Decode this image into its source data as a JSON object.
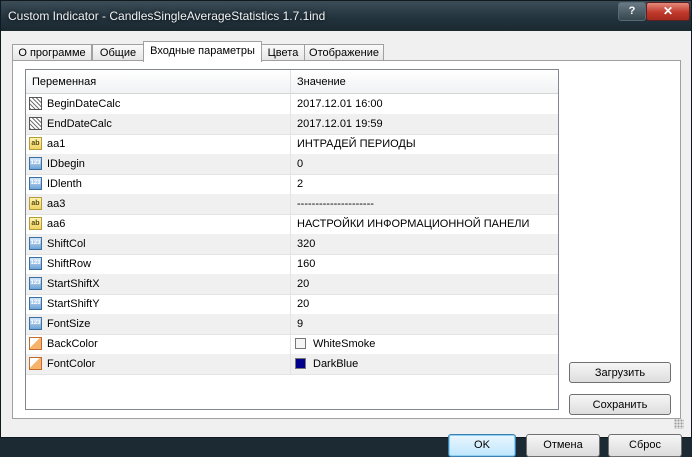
{
  "window": {
    "title": "Custom Indicator - CandlesSingleAverageStatistics 1.7.1ind",
    "help_label": "?",
    "close_label": "✕"
  },
  "tabs": [
    {
      "label": "О программе",
      "active": false
    },
    {
      "label": "Общие",
      "active": false
    },
    {
      "label": "Входные параметры",
      "active": true
    },
    {
      "label": "Цвета",
      "active": false
    },
    {
      "label": "Отображение",
      "active": false
    }
  ],
  "grid": {
    "headers": {
      "name": "Переменная",
      "value": "Значение"
    },
    "rows": [
      {
        "icon": "datetime-icon",
        "name": "BeginDateCalc",
        "value": "2017.12.01 16:00"
      },
      {
        "icon": "datetime-icon",
        "name": "EndDateCalc",
        "value": "2017.12.01 19:59"
      },
      {
        "icon": "string-icon",
        "name": "aa1",
        "value": "ИНТРАДЕЙ ПЕРИОДЫ"
      },
      {
        "icon": "integer-icon",
        "name": "IDbegin",
        "value": "0"
      },
      {
        "icon": "integer-icon",
        "name": "IDlenth",
        "value": "2"
      },
      {
        "icon": "string-icon",
        "name": "aa3",
        "value": "---------------------"
      },
      {
        "icon": "string-icon",
        "name": "aa6",
        "value": "НАСТРОЙКИ ИНФОРМАЦИОННОЙ ПАНЕЛИ"
      },
      {
        "icon": "integer-icon",
        "name": "ShiftCol",
        "value": "320"
      },
      {
        "icon": "integer-icon",
        "name": "ShiftRow",
        "value": "160"
      },
      {
        "icon": "integer-icon",
        "name": "StartShiftX",
        "value": "20"
      },
      {
        "icon": "integer-icon",
        "name": "StartShiftY",
        "value": "20"
      },
      {
        "icon": "integer-icon",
        "name": "FontSize",
        "value": "9"
      },
      {
        "icon": "color-icon",
        "name": "BackColor",
        "value": "WhiteSmoke",
        "swatch": "#f5f5f5"
      },
      {
        "icon": "color-icon",
        "name": "FontColor",
        "value": "DarkBlue",
        "swatch": "#00008b"
      }
    ]
  },
  "side_buttons": {
    "load_label": "Загрузить",
    "save_label": "Сохранить"
  },
  "footer": {
    "ok_label": "OK",
    "cancel_label": "Отмена",
    "reset_label": "Сброс"
  },
  "icon_glyphs": {
    "string": "ab",
    "integer": "123"
  }
}
